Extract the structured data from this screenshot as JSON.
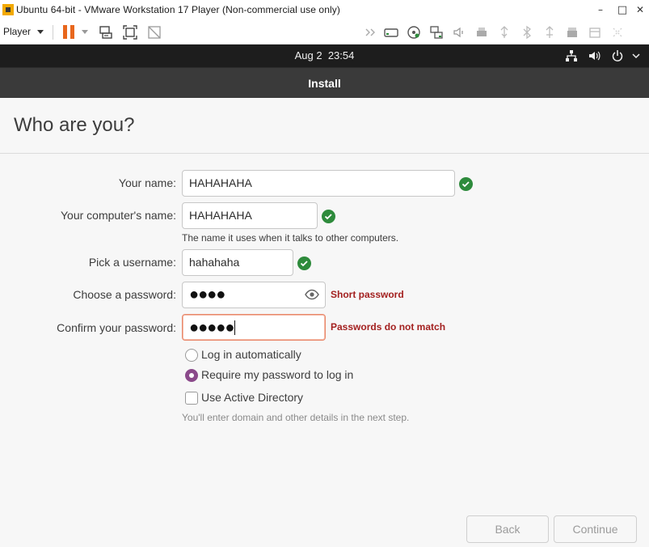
{
  "window": {
    "title": "Ubuntu 64-bit - VMware Workstation 17 Player (Non-commercial use only)",
    "minimize_glyph": "–",
    "maximize_glyph": "□",
    "close_glyph": "✕"
  },
  "toolbar": {
    "player_menu_label": "Player",
    "icons": [
      "pause-icon",
      "send-ctrl-alt-del-icon",
      "fit-guest-icon",
      "unity-icon",
      "forward-icon",
      "hard-disk-icon",
      "cd-dvd-icon",
      "network-adapter-icon",
      "sound-card-icon",
      "printer-icon",
      "usb-icon",
      "bluetooth-icon",
      "usb-device-icon",
      "floppy-icon",
      "removable-device-icon",
      "more-icon"
    ]
  },
  "topbar": {
    "date": "Aug 2",
    "time": "23:54"
  },
  "installer": {
    "header_title": "Install",
    "page_title": "Who are you?",
    "fields": {
      "name": {
        "label": "Your name:",
        "value": "HAHAHAHA"
      },
      "computer": {
        "label": "Your computer's name:",
        "value": "HAHAHAHA",
        "hint": "The name it uses when it talks to other computers."
      },
      "username": {
        "label": "Pick a username:",
        "value": "hahahaha"
      },
      "password": {
        "label": "Choose a password:",
        "value": "●●●●",
        "error": "Short password"
      },
      "confirm": {
        "label": "Confirm your password:",
        "value": "●●●●●",
        "error": "Passwords do not match"
      }
    },
    "options": {
      "auto_login": {
        "label": "Log in automatically",
        "checked": false
      },
      "require_password": {
        "label": "Require my password to log in",
        "checked": true
      },
      "active_directory": {
        "label": "Use Active Directory",
        "checked": false,
        "hint": "You'll enter domain and other details in the next step."
      }
    },
    "buttons": {
      "back": "Back",
      "continue": "Continue"
    }
  },
  "colors": {
    "accent_purple": "#8b4a8b",
    "valid_green": "#2e8b3c",
    "error_red": "#a3201f",
    "pause_orange": "#e8671d"
  }
}
